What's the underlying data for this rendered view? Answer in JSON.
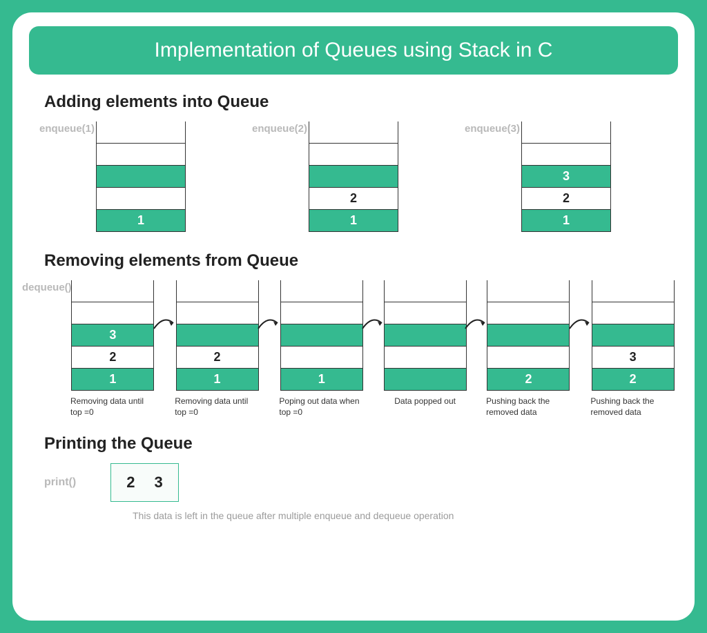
{
  "title": "Implementation of Queues using Stack in C",
  "adding": {
    "heading": "Adding elements into Queue",
    "stacks": [
      {
        "label": "enqueue(1)",
        "cells": [
          "",
          "",
          "",
          "",
          "1"
        ]
      },
      {
        "label": "enqueue(2)",
        "cells": [
          "",
          "",
          "",
          "2",
          "1"
        ]
      },
      {
        "label": "enqueue(3)",
        "cells": [
          "",
          "",
          "3",
          "2",
          "1"
        ]
      }
    ]
  },
  "removing": {
    "heading": "Removing elements from Queue",
    "label": "dequeue()",
    "steps": [
      {
        "cells": [
          "",
          "",
          "3",
          "2",
          "1"
        ],
        "caption": "Removing data until top =0"
      },
      {
        "cells": [
          "",
          "",
          "",
          "2",
          "1"
        ],
        "caption": "Removing data until top =0"
      },
      {
        "cells": [
          "",
          "",
          "",
          "",
          "1"
        ],
        "caption": "Poping out data when top =0"
      },
      {
        "cells": [
          "",
          "",
          "",
          "",
          ""
        ],
        "caption": "Data popped out"
      },
      {
        "cells": [
          "",
          "",
          "",
          "",
          "2"
        ],
        "caption": "Pushing back the removed data"
      },
      {
        "cells": [
          "",
          "",
          "",
          "3",
          "2"
        ],
        "caption": "Pushing back the removed data"
      }
    ]
  },
  "printing": {
    "heading": "Printing the Queue",
    "label": "print()",
    "values": [
      "2",
      "3"
    ],
    "note": "This data is left in the queue after multiple enqueue and dequeue operation"
  }
}
